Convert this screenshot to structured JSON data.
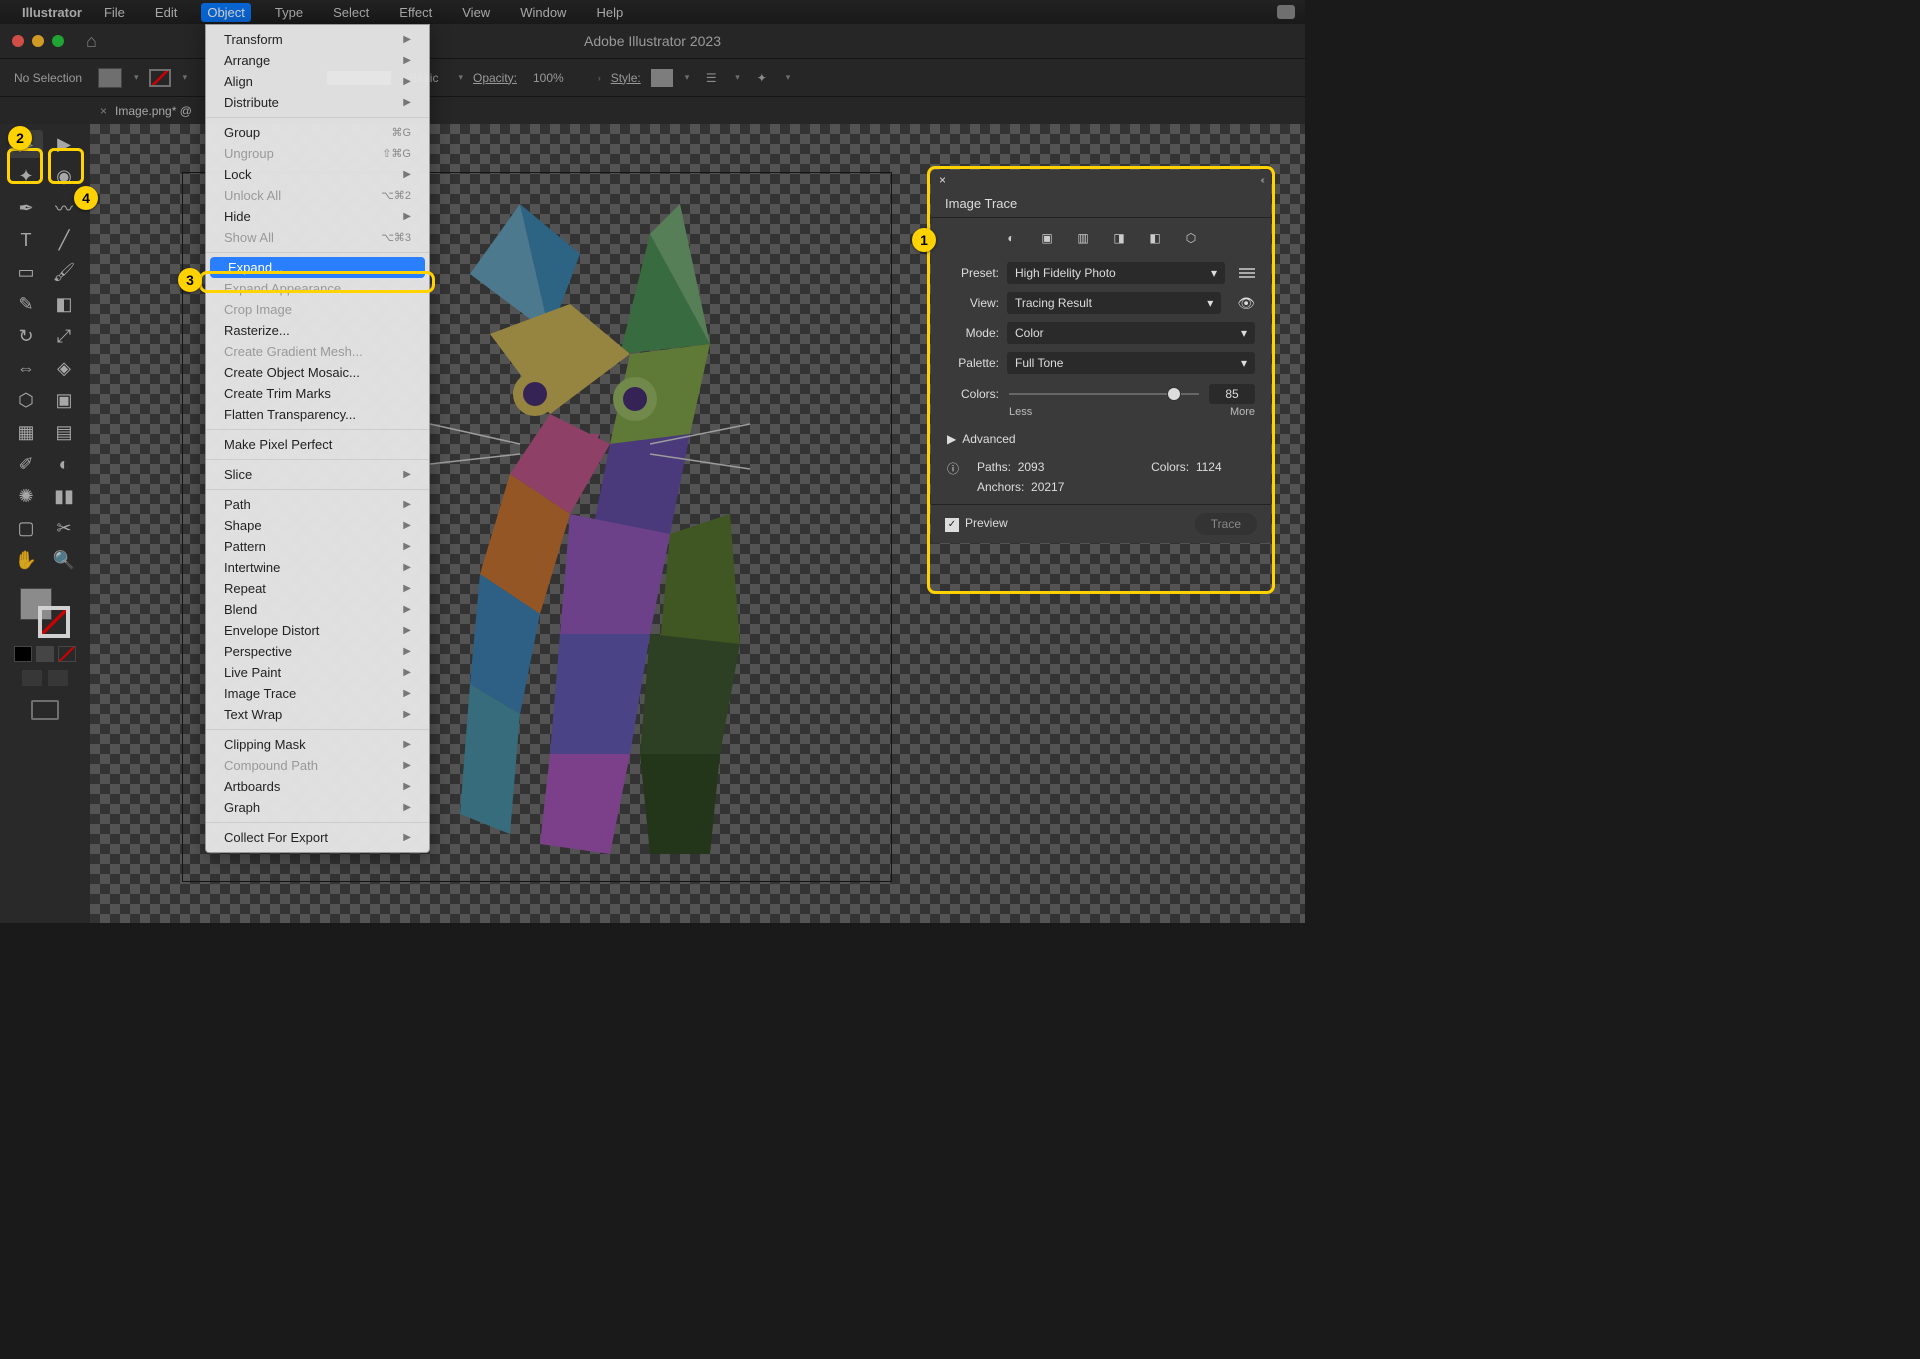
{
  "mac_menu": {
    "app": "Illustrator",
    "items": [
      "File",
      "Edit",
      "Object",
      "Type",
      "Select",
      "Effect",
      "View",
      "Window",
      "Help"
    ],
    "open_index": 2
  },
  "window": {
    "title": "Adobe Illustrator 2023"
  },
  "options": {
    "selection": "No Selection",
    "basic": "Basic",
    "opacity_label": "Opacity:",
    "opacity_value": "100%",
    "style_label": "Style:"
  },
  "tabs": {
    "doc": "Image.png* @"
  },
  "obj_menu": {
    "groups": [
      [
        {
          "label": "Transform",
          "sub": true
        },
        {
          "label": "Arrange",
          "sub": true
        },
        {
          "label": "Align",
          "sub": true
        },
        {
          "label": "Distribute",
          "sub": true
        }
      ],
      [
        {
          "label": "Group",
          "shortcut": "⌘G"
        },
        {
          "label": "Ungroup",
          "shortcut": "⇧⌘G",
          "disabled": true
        },
        {
          "label": "Lock",
          "sub": true
        },
        {
          "label": "Unlock All",
          "shortcut": "⌥⌘2",
          "disabled": true
        },
        {
          "label": "Hide",
          "sub": true
        },
        {
          "label": "Show All",
          "shortcut": "⌥⌘3",
          "disabled": true
        }
      ],
      [
        {
          "label": "Expand...",
          "highlight": true
        },
        {
          "label": "Expand Appearance",
          "disabled": true
        },
        {
          "label": "Crop Image",
          "disabled": true
        },
        {
          "label": "Rasterize..."
        },
        {
          "label": "Create Gradient Mesh...",
          "disabled": true
        },
        {
          "label": "Create Object Mosaic..."
        },
        {
          "label": "Create Trim Marks"
        },
        {
          "label": "Flatten Transparency..."
        }
      ],
      [
        {
          "label": "Make Pixel Perfect"
        }
      ],
      [
        {
          "label": "Slice",
          "sub": true
        }
      ],
      [
        {
          "label": "Path",
          "sub": true
        },
        {
          "label": "Shape",
          "sub": true
        },
        {
          "label": "Pattern",
          "sub": true
        },
        {
          "label": "Intertwine",
          "sub": true
        },
        {
          "label": "Repeat",
          "sub": true
        },
        {
          "label": "Blend",
          "sub": true
        },
        {
          "label": "Envelope Distort",
          "sub": true
        },
        {
          "label": "Perspective",
          "sub": true
        },
        {
          "label": "Live Paint",
          "sub": true
        },
        {
          "label": "Image Trace",
          "sub": true
        },
        {
          "label": "Text Wrap",
          "sub": true
        }
      ],
      [
        {
          "label": "Clipping Mask",
          "sub": true
        },
        {
          "label": "Compound Path",
          "sub": true,
          "disabled": true
        },
        {
          "label": "Artboards",
          "sub": true
        },
        {
          "label": "Graph",
          "sub": true
        }
      ],
      [
        {
          "label": "Collect For Export",
          "sub": true
        }
      ]
    ]
  },
  "image_trace": {
    "title": "Image Trace",
    "preset_label": "Preset:",
    "preset_value": "High Fidelity Photo",
    "view_label": "View:",
    "view_value": "Tracing Result",
    "mode_label": "Mode:",
    "mode_value": "Color",
    "palette_label": "Palette:",
    "palette_value": "Full Tone",
    "colors_label": "Colors:",
    "colors_value": "85",
    "less": "Less",
    "more": "More",
    "advanced": "Advanced",
    "paths_label": "Paths:",
    "paths_value": "2093",
    "colors_stat_label": "Colors:",
    "colors_stat_value": "1124",
    "anchors_label": "Anchors:",
    "anchors_value": "20217",
    "preview": "Preview",
    "trace": "Trace"
  },
  "callouts": {
    "c1": "1",
    "c2": "2",
    "c3": "3",
    "c4": "4"
  }
}
